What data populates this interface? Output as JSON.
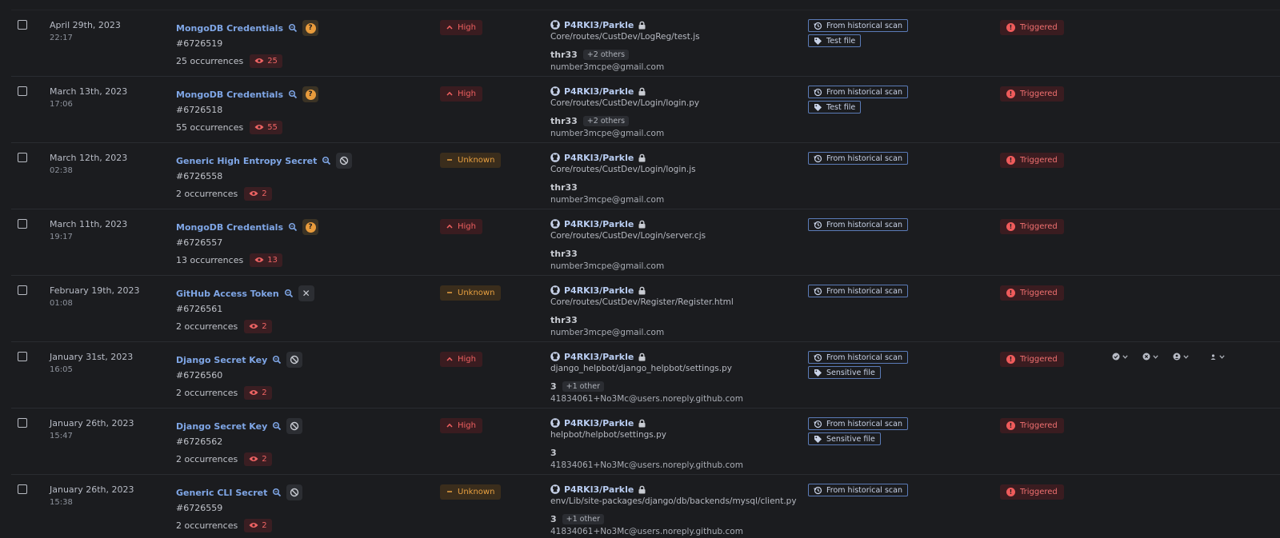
{
  "rows": [
    {
      "date": "April 29th, 2023",
      "time": "22:17",
      "name": "MongoDB Credentials",
      "marker": "question",
      "id": "#6726519",
      "occ": "25 occurrences",
      "eye": "25",
      "severity": "High",
      "sev_kind": "high",
      "repo": "P4RKl3/Parkle",
      "path": "Core/routes/CustDev/LogReg/test.js",
      "author": "thr33",
      "others": "+2 others",
      "email": "number3mcpe@gmail.com",
      "tags": [
        "From historical scan",
        "Test file"
      ],
      "status": "Triggered",
      "actions": false
    },
    {
      "date": "March 13th, 2023",
      "time": "17:06",
      "name": "MongoDB Credentials",
      "marker": "question",
      "id": "#6726518",
      "occ": "55 occurrences",
      "eye": "55",
      "severity": "High",
      "sev_kind": "high",
      "repo": "P4RKl3/Parkle",
      "path": "Core/routes/CustDev/Login/login.py",
      "author": "thr33",
      "others": "+2 others",
      "email": "number3mcpe@gmail.com",
      "tags": [
        "From historical scan",
        "Test file"
      ],
      "status": "Triggered",
      "actions": false
    },
    {
      "date": "March 12th, 2023",
      "time": "02:38",
      "name": "Generic High Entropy Secret",
      "marker": "ban",
      "id": "#6726558",
      "occ": "2 occurrences",
      "eye": "2",
      "severity": "Unknown",
      "sev_kind": "unk",
      "repo": "P4RKl3/Parkle",
      "path": "Core/routes/CustDev/Login/login.js",
      "author": "thr33",
      "others": "",
      "email": "number3mcpe@gmail.com",
      "tags": [
        "From historical scan"
      ],
      "status": "Triggered",
      "actions": false
    },
    {
      "date": "March 11th, 2023",
      "time": "19:17",
      "name": "MongoDB Credentials",
      "marker": "question",
      "id": "#6726557",
      "occ": "13 occurrences",
      "eye": "13",
      "severity": "High",
      "sev_kind": "high",
      "repo": "P4RKl3/Parkle",
      "path": "Core/routes/CustDev/Login/server.cjs",
      "author": "thr33",
      "others": "",
      "email": "number3mcpe@gmail.com",
      "tags": [
        "From historical scan"
      ],
      "status": "Triggered",
      "actions": false
    },
    {
      "date": "February 19th, 2023",
      "time": "01:08",
      "name": "GitHub Access Token",
      "marker": "x",
      "id": "#6726561",
      "occ": "2 occurrences",
      "eye": "2",
      "severity": "Unknown",
      "sev_kind": "unk",
      "repo": "P4RKl3/Parkle",
      "path": "Core/routes/CustDev/Register/Register.html",
      "author": "thr33",
      "others": "",
      "email": "number3mcpe@gmail.com",
      "tags": [
        "From historical scan"
      ],
      "status": "Triggered",
      "actions": false
    },
    {
      "date": "January 31st, 2023",
      "time": "16:05",
      "name": "Django Secret Key",
      "marker": "ban",
      "id": "#6726560",
      "occ": "2 occurrences",
      "eye": "2",
      "severity": "High",
      "sev_kind": "high",
      "repo": "P4RKl3/Parkle",
      "path": "django_helpbot/django_helpbot/settings.py",
      "author": "3",
      "others": "+1 other",
      "email": "41834061+No3Mc@users.noreply.github.com",
      "tags": [
        "From historical scan",
        "Sensitive file"
      ],
      "status": "Triggered",
      "actions": true
    },
    {
      "date": "January 26th, 2023",
      "time": "15:47",
      "name": "Django Secret Key",
      "marker": "ban",
      "id": "#6726562",
      "occ": "2 occurrences",
      "eye": "2",
      "severity": "High",
      "sev_kind": "high",
      "repo": "P4RKl3/Parkle",
      "path": "helpbot/helpbot/settings.py",
      "author": "3",
      "others": "",
      "email": "41834061+No3Mc@users.noreply.github.com",
      "tags": [
        "From historical scan",
        "Sensitive file"
      ],
      "status": "Triggered",
      "actions": false
    },
    {
      "date": "January 26th, 2023",
      "time": "15:38",
      "name": "Generic CLI Secret",
      "marker": "ban",
      "id": "#6726559",
      "occ": "2 occurrences",
      "eye": "2",
      "severity": "Unknown",
      "sev_kind": "unk",
      "repo": "P4RKl3/Parkle",
      "path": "env/Lib/site-packages/django/db/backends/mysql/client.py",
      "author": "3",
      "others": "+1 other",
      "email": "41834061+No3Mc@users.noreply.github.com",
      "tags": [
        "From historical scan"
      ],
      "status": "Triggered",
      "actions": false
    }
  ],
  "icons": {
    "magnify": "magnify-icon",
    "eye": "eye-icon",
    "github": "github-icon",
    "lock": "lock-icon",
    "history": "history-icon",
    "tag": "tag-icon",
    "alert": "alert-circle-icon",
    "check": "check-circle-icon",
    "close": "close-circle-icon",
    "user": "user-circle-icon",
    "person": "person-icon",
    "chevron": "chevron-down-icon"
  },
  "colors": {
    "bg": "#1b1c1f",
    "link": "#7fa6e6",
    "high": "#f06060",
    "unknown": "#e8a040",
    "triggered": "#ef5b5b",
    "tag_border": "#5b7bb7"
  }
}
